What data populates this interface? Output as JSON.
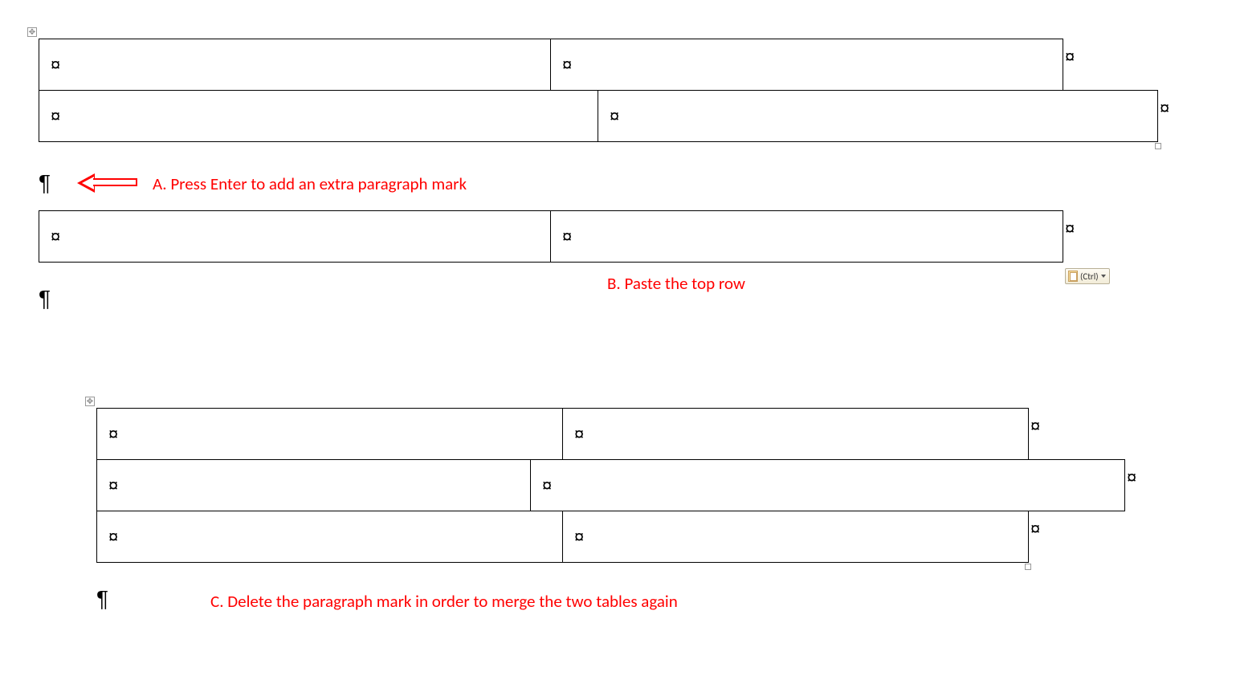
{
  "marks": {
    "cell": "¤",
    "end": "¤",
    "pilcrow": "¶",
    "anchor": "✥"
  },
  "annotations": {
    "a": "A. Press Enter to add an extra paragraph mark",
    "b": "B. Paste the top row",
    "c": "C. Delete the paragraph mark in order to merge the two tables again"
  },
  "paste": {
    "label": "(Ctrl)"
  }
}
